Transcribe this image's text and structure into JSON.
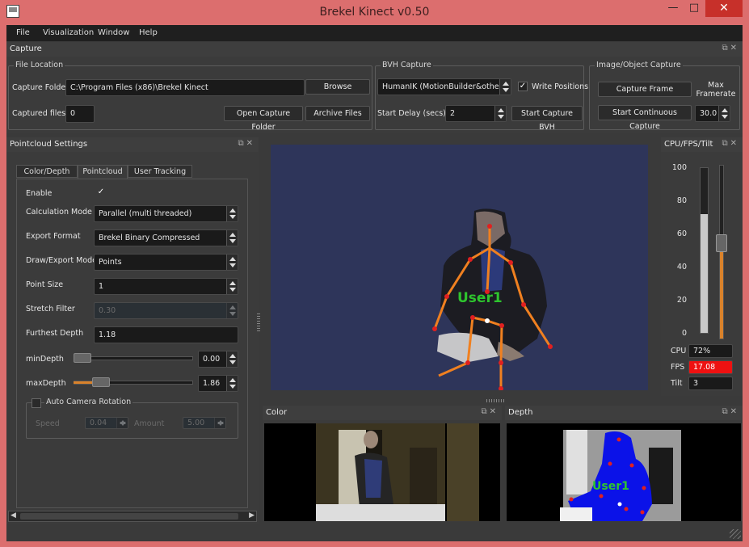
{
  "window": {
    "title": "Brekel Kinect v0.50",
    "min_glyph": "—",
    "max_glyph": "□",
    "close_glyph": "✕"
  },
  "menu": [
    "File",
    "Visualization",
    "Window",
    "Help"
  ],
  "capture": {
    "title": "Capture",
    "file_location": {
      "title": "File Location",
      "folder_label": "Capture Folder",
      "folder_value": "C:\\Program Files (x86)\\Brekel Kinect",
      "browse": "Browse",
      "captured_label": "Captured files",
      "captured_value": "0",
      "open_folder": "Open Capture Folder",
      "archive": "Archive Files"
    },
    "bvh": {
      "title": "BVH Capture",
      "format": "HumanIK (MotionBuilder&others)",
      "write_positions": "Write Positions",
      "delay_label": "Start Delay (secs)",
      "delay_value": "2",
      "start": "Start Capture BVH"
    },
    "image": {
      "title": "Image/Object Capture",
      "capture_frame": "Capture Frame",
      "continuous": "Start Continuous Capture",
      "max_framerate": "Max Framerate",
      "framerate_value": "30.0"
    }
  },
  "pointcloud": {
    "title": "Pointcloud Settings",
    "tabs": [
      "Color/Depth",
      "Pointcloud",
      "User Tracking"
    ],
    "enable_label": "Enable",
    "calc_label": "Calculation Mode",
    "calc_value": "Parallel (multi threaded)",
    "export_label": "Export Format",
    "export_value": "Brekel Binary Compressed",
    "draw_label": "Draw/Export Mode",
    "draw_value": "Points",
    "point_size_label": "Point Size",
    "point_size_value": "1",
    "stretch_label": "Stretch Filter",
    "stretch_value": "0.30",
    "furthest_label": "Furthest Depth",
    "furthest_value": "1.18",
    "min_label": "minDepth",
    "min_value": "0.00",
    "max_label": "maxDepth",
    "max_value": "1.86",
    "auto_rot": {
      "title": "Auto Camera Rotation",
      "speed_label": "Speed",
      "speed_value": "0.04",
      "amount_label": "Amount",
      "amount_value": "5.00"
    }
  },
  "viewport": {
    "user_label": "User1",
    "bg_color": "#2e355a",
    "skeleton_color": "#f08020"
  },
  "cpu": {
    "title": "CPU/FPS/Tilt",
    "ticks": [
      "100",
      "80",
      "60",
      "40",
      "20",
      "0"
    ],
    "cpu_label": "CPU",
    "cpu_value": "72%",
    "cpu_level": 0.72,
    "fps_label": "FPS",
    "fps_value": "17.08",
    "tilt_label": "Tilt",
    "tilt_value": "3",
    "tilt_level": 0.55
  },
  "color_panel": {
    "title": "Color"
  },
  "depth_panel": {
    "title": "Depth",
    "user_label": "User1"
  }
}
